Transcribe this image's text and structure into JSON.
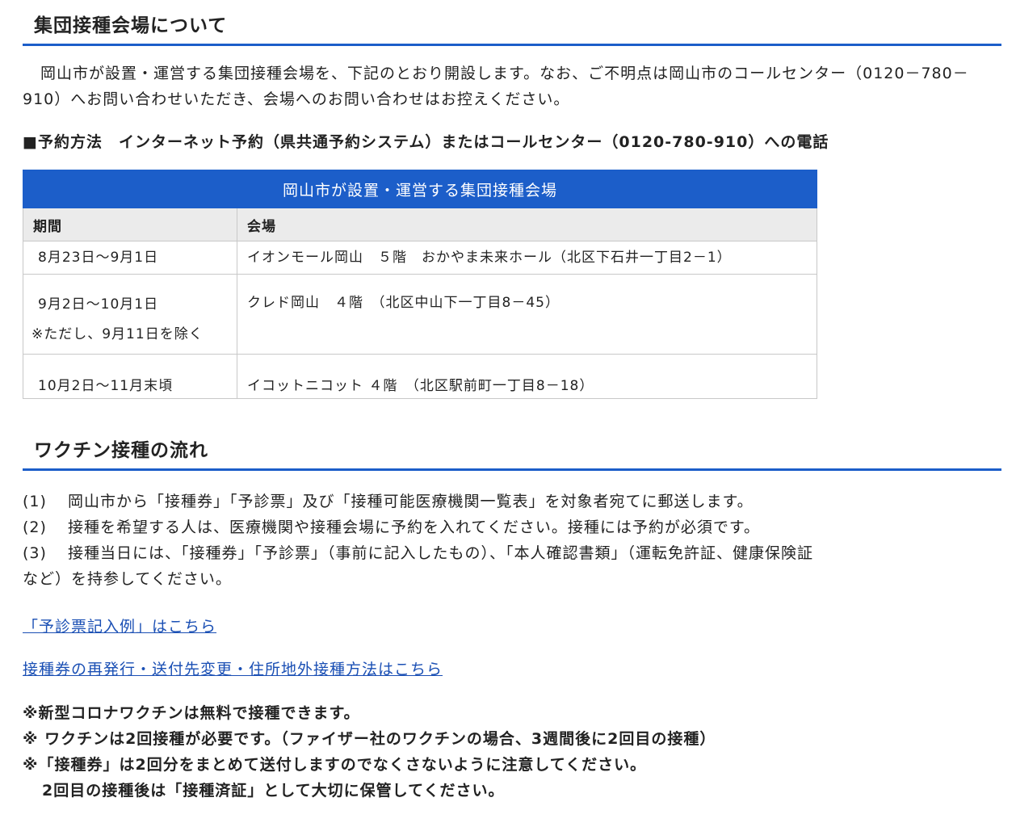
{
  "section1": {
    "heading": "集団接種会場について",
    "intro": "岡山市が設置・運営する集団接種会場を、下記のとおり開設します。なお、ご不明点は岡山市のコールセンター（0120－780－910）へお問い合わせいただき、会場へのお問い合わせはお控えください。",
    "booking": "■予約方法　インターネット予約（県共通予約システム）またはコールセンター（0120-780-910）への電話"
  },
  "table": {
    "caption": "岡山市が設置・運営する集団接種会場",
    "headers": [
      "期間",
      "会場"
    ],
    "rows": [
      {
        "period": "8月23日～9月1日",
        "note": "",
        "venue": "イオンモール岡山　５階　おかやま未来ホール（北区下石井一丁目2－1）"
      },
      {
        "period": "9月2日～10月1日",
        "note": "※ただし、9月11日を除く",
        "venue": "クレド岡山　４階　（北区中山下一丁目8－45）"
      },
      {
        "period": "10月2日～11月末頃",
        "note": "",
        "venue": "イコットニコット ４階　（北区駅前町一丁目8－18）"
      }
    ]
  },
  "section2": {
    "heading": "ワクチン接種の流れ",
    "steps": [
      {
        "num": "(1)",
        "text": "岡山市から「接種券」「予診票」及び「接種可能医療機関一覧表」を対象者宛てに郵送します。"
      },
      {
        "num": "(2)",
        "text": "接種を希望する人は、医療機関や接種会場に予約を入れてください。接種には予約が必須です。"
      },
      {
        "num": "(3)",
        "text": "接種当日には、「接種券」「予診票」（事前に記入したもの）、「本人確認書類」（運転免許証、健康保険証",
        "cont": "など）を持参してください。"
      }
    ],
    "links": [
      "「予診票記入例」はこちら",
      "接種券の再発行・送付先変更・住所地外接種方法はこちら"
    ],
    "notes": [
      "※新型コロナワクチンは無料で接種できます。",
      "※ ワクチンは2回接種が必要です。（ファイザー社のワクチンの場合、3週間後に2回目の接種）",
      "※「接種券」は2回分をまとめて送付しますのでなくさないように注意してください。",
      "2回目の接種後は「接種済証」として大切に保管してください。"
    ]
  },
  "colors": {
    "accent": "#1c5ec9",
    "link": "#1a4fb4",
    "header_bg": "#ebebeb"
  }
}
